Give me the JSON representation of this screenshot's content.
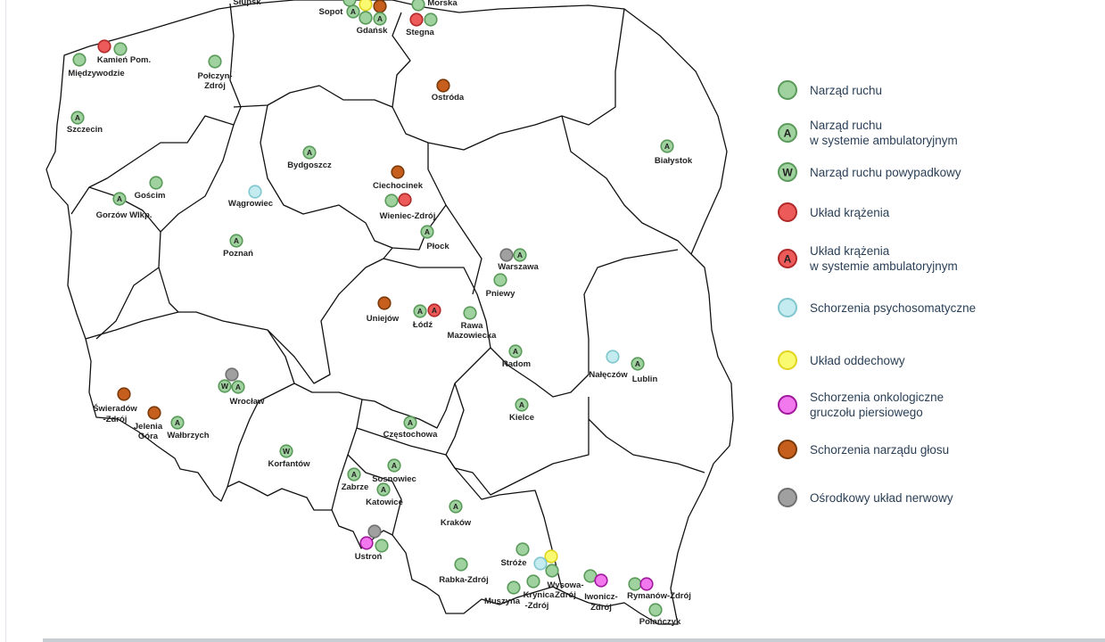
{
  "map": {
    "category_colors": {
      "ruch": "#9fd29f",
      "krazenie": "#ec5a5a",
      "psycho": "#c4ebef",
      "oddech": "#fafa70",
      "onko": "#f278ee",
      "glos": "#c65f1d",
      "nerw": "#a0a0a0"
    },
    "stroke_colors": {
      "ruch": "#5a9a5a",
      "krazenie": "#b02a2a",
      "psycho": "#7fc6cf",
      "oddech": "#e0d420",
      "onko": "#a0189c",
      "glos": "#7a3a0a",
      "nerw": "#707070"
    },
    "markers": [
      {
        "id": "gdynia-yellow",
        "cat": "oddech",
        "letter": ""
      },
      {
        "id": "gdansk-brown",
        "cat": "glos",
        "letter": ""
      },
      {
        "id": "sopot-ruch",
        "cat": "ruch",
        "letter": ""
      },
      {
        "id": "sopot-a",
        "cat": "ruch",
        "letter": "A"
      },
      {
        "id": "gdansk-ruch",
        "cat": "ruch",
        "letter": ""
      },
      {
        "id": "gdansk-a",
        "cat": "ruch",
        "letter": "A"
      },
      {
        "id": "slupsk-ruch",
        "cat": "ruch",
        "letter": ""
      },
      {
        "id": "morska-ruch",
        "cat": "ruch",
        "letter": ""
      },
      {
        "id": "stegna-red",
        "cat": "krazenie",
        "letter": ""
      },
      {
        "id": "stegna-ruch",
        "cat": "ruch",
        "letter": ""
      },
      {
        "id": "kamien-red",
        "cat": "krazenie",
        "letter": ""
      },
      {
        "id": "kamien-ruch",
        "cat": "ruch",
        "letter": ""
      },
      {
        "id": "miedzywodzie-ruch",
        "cat": "ruch",
        "letter": ""
      },
      {
        "id": "polczyn-ruch",
        "cat": "ruch",
        "letter": ""
      },
      {
        "id": "szczecin-a",
        "cat": "ruch",
        "letter": "A"
      },
      {
        "id": "ostroda-brown",
        "cat": "glos",
        "letter": ""
      },
      {
        "id": "bialystok-a",
        "cat": "ruch",
        "letter": "A"
      },
      {
        "id": "bydgoszcz-a",
        "cat": "ruch",
        "letter": "A"
      },
      {
        "id": "ciechocinek-brown",
        "cat": "glos",
        "letter": ""
      },
      {
        "id": "wieniec-ruch",
        "cat": "ruch",
        "letter": ""
      },
      {
        "id": "wieniec-red",
        "cat": "krazenie",
        "letter": ""
      },
      {
        "id": "wagrowiec-psycho",
        "cat": "psycho",
        "letter": ""
      },
      {
        "id": "goscim-ruch",
        "cat": "ruch",
        "letter": ""
      },
      {
        "id": "gorzow-a",
        "cat": "ruch",
        "letter": "A"
      },
      {
        "id": "poznan-a",
        "cat": "ruch",
        "letter": "A"
      },
      {
        "id": "plock-a",
        "cat": "ruch",
        "letter": "A"
      },
      {
        "id": "warszawa-grey",
        "cat": "nerw",
        "letter": ""
      },
      {
        "id": "warszawa-a",
        "cat": "ruch",
        "letter": "A"
      },
      {
        "id": "pniewy-ruch",
        "cat": "ruch",
        "letter": ""
      },
      {
        "id": "uniejow-brown",
        "cat": "glos",
        "letter": ""
      },
      {
        "id": "lodz-a",
        "cat": "ruch",
        "letter": "A"
      },
      {
        "id": "lodz-reda",
        "cat": "krazenie",
        "letter": "A"
      },
      {
        "id": "rawa-ruch",
        "cat": "ruch",
        "letter": ""
      },
      {
        "id": "radom-a",
        "cat": "ruch",
        "letter": "A"
      },
      {
        "id": "naleczow-psycho",
        "cat": "psycho",
        "letter": ""
      },
      {
        "id": "lublin-a",
        "cat": "ruch",
        "letter": "A"
      },
      {
        "id": "kielce-a",
        "cat": "ruch",
        "letter": "A"
      },
      {
        "id": "wroclaw-grey",
        "cat": "nerw",
        "letter": ""
      },
      {
        "id": "wroclaw-w",
        "cat": "ruch",
        "letter": "W"
      },
      {
        "id": "wroclaw-a",
        "cat": "ruch",
        "letter": "A"
      },
      {
        "id": "swieradow-brown",
        "cat": "glos",
        "letter": ""
      },
      {
        "id": "jelenia-brown",
        "cat": "glos",
        "letter": ""
      },
      {
        "id": "walbrzych-a",
        "cat": "ruch",
        "letter": "A"
      },
      {
        "id": "czestochowa-a",
        "cat": "ruch",
        "letter": "A"
      },
      {
        "id": "korfantow-w",
        "cat": "ruch",
        "letter": "W"
      },
      {
        "id": "zabrze-a",
        "cat": "ruch",
        "letter": "A"
      },
      {
        "id": "sosnowiec-a",
        "cat": "ruch",
        "letter": "A"
      },
      {
        "id": "katowice-a",
        "cat": "ruch",
        "letter": "A"
      },
      {
        "id": "krakow-a",
        "cat": "ruch",
        "letter": "A"
      },
      {
        "id": "ustron-grey",
        "cat": "nerw",
        "letter": ""
      },
      {
        "id": "ustron-onko",
        "cat": "onko",
        "letter": ""
      },
      {
        "id": "ustron-ruch",
        "cat": "ruch",
        "letter": ""
      },
      {
        "id": "rabka-ruch",
        "cat": "ruch",
        "letter": ""
      },
      {
        "id": "stroze-ruch",
        "cat": "ruch",
        "letter": ""
      },
      {
        "id": "wysowa-yellow",
        "cat": "oddech",
        "letter": ""
      },
      {
        "id": "wysowa-psycho",
        "cat": "psycho",
        "letter": ""
      },
      {
        "id": "wysowa-ruch",
        "cat": "ruch",
        "letter": ""
      },
      {
        "id": "krynica-ruch",
        "cat": "ruch",
        "letter": ""
      },
      {
        "id": "muszyna-ruch",
        "cat": "ruch",
        "letter": ""
      },
      {
        "id": "iwonicz-ruch",
        "cat": "ruch",
        "letter": ""
      },
      {
        "id": "iwonicz-onko",
        "cat": "onko",
        "letter": ""
      },
      {
        "id": "rymanow-ruch",
        "cat": "ruch",
        "letter": ""
      },
      {
        "id": "rymanow-onko",
        "cat": "onko",
        "letter": ""
      },
      {
        "id": "polanczyk-ruch",
        "cat": "ruch",
        "letter": ""
      }
    ],
    "labels": [
      {
        "id": "slupsk",
        "text": "Słupsk"
      },
      {
        "id": "sopot",
        "text": "Sopot"
      },
      {
        "id": "gdansk",
        "text": "Gdańsk"
      },
      {
        "id": "morska",
        "text": "Morska"
      },
      {
        "id": "stegna",
        "text": "Stegna"
      },
      {
        "id": "kamien",
        "text": "Kamień Pom."
      },
      {
        "id": "miedzywodzie",
        "text": "Międzywodzie"
      },
      {
        "id": "polczyn1",
        "text": "Połczyn-"
      },
      {
        "id": "polczyn2",
        "text": "Zdrój"
      },
      {
        "id": "ostroda",
        "text": "Ostróda"
      },
      {
        "id": "szczecin",
        "text": "Szczecin"
      },
      {
        "id": "bialystok",
        "text": "Białystok"
      },
      {
        "id": "bydgoszcz",
        "text": "Bydgoszcz"
      },
      {
        "id": "ciechocinek",
        "text": "Ciechocinek"
      },
      {
        "id": "wieniec",
        "text": "Wieniec-Zdrój"
      },
      {
        "id": "wagrowiec",
        "text": "Wągrowiec"
      },
      {
        "id": "goscim",
        "text": "Gościm"
      },
      {
        "id": "gorzow",
        "text": "Gorzów Wlkp."
      },
      {
        "id": "poznan",
        "text": "Poznań"
      },
      {
        "id": "plock",
        "text": "Płock"
      },
      {
        "id": "warszawa",
        "text": "Warszawa"
      },
      {
        "id": "pniewy",
        "text": "Pniewy"
      },
      {
        "id": "uniejow",
        "text": "Uniejów"
      },
      {
        "id": "lodz",
        "text": "Łódź"
      },
      {
        "id": "rawa1",
        "text": "Rawa"
      },
      {
        "id": "rawa2",
        "text": "Mazowiecka"
      },
      {
        "id": "radom",
        "text": "Radom"
      },
      {
        "id": "naleczow",
        "text": "Nałęczów"
      },
      {
        "id": "lublin",
        "text": "Lublin"
      },
      {
        "id": "kielce",
        "text": "Kielce"
      },
      {
        "id": "wroclaw",
        "text": "Wrocław"
      },
      {
        "id": "swieradow1",
        "text": "Świeradów"
      },
      {
        "id": "swieradow2",
        "text": "-Zdrój"
      },
      {
        "id": "jelenia1",
        "text": "Jelenia"
      },
      {
        "id": "jelenia2",
        "text": "Góra"
      },
      {
        "id": "walbrzych",
        "text": "Wałbrzych"
      },
      {
        "id": "czestochowa",
        "text": "Częstochowa"
      },
      {
        "id": "korfantow",
        "text": "Korfantów"
      },
      {
        "id": "zabrze",
        "text": "Zabrze"
      },
      {
        "id": "sosnowiec",
        "text": "Sosnowiec"
      },
      {
        "id": "katowice",
        "text": "Katowice"
      },
      {
        "id": "krakow",
        "text": "Kraków"
      },
      {
        "id": "ustron",
        "text": "Ustroń"
      },
      {
        "id": "rabka",
        "text": "Rabka-Zdrój"
      },
      {
        "id": "stroze",
        "text": "Stróże"
      },
      {
        "id": "wysowa1",
        "text": "Wysowa-"
      },
      {
        "id": "wysowa2",
        "text": "Zdrój"
      },
      {
        "id": "krynica1",
        "text": "Krynica"
      },
      {
        "id": "krynica2",
        "text": "-Zdrój"
      },
      {
        "id": "muszyna",
        "text": "Muszyna"
      },
      {
        "id": "iwonicz1",
        "text": "Iwonicz-"
      },
      {
        "id": "iwonicz2",
        "text": "Zdrój"
      },
      {
        "id": "rymanow",
        "text": "Rymanów-Zdrój"
      },
      {
        "id": "polanczyk",
        "text": "Polańczyk"
      }
    ]
  },
  "legend": {
    "items": [
      {
        "cat": "ruch",
        "letter": "",
        "label": "Narząd ruchu"
      },
      {
        "cat": "ruch",
        "letter": "A",
        "label": "Narząd ruchu\nw systemie ambulatoryjnym"
      },
      {
        "cat": "ruch",
        "letter": "W",
        "label": "Narząd ruchu powypadkowy"
      },
      {
        "cat": "krazenie",
        "letter": "",
        "label": "Układ krążenia"
      },
      {
        "cat": "krazenie",
        "letter": "A",
        "label": "Układ krążenia\nw systemie ambulatoryjnym"
      },
      {
        "cat": "psycho",
        "letter": "",
        "label": "Schorzenia psychosomatyczne"
      },
      {
        "cat": "oddech",
        "letter": "",
        "label": "Układ oddechowy"
      },
      {
        "cat": "onko",
        "letter": "",
        "label": "Schorzenia onkologiczne\ngruczołu piersiowego"
      },
      {
        "cat": "glos",
        "letter": "",
        "label": "Schorzenia narządu głosu"
      },
      {
        "cat": "nerw",
        "letter": "",
        "label": "Ośrodkowy układ nerwowy"
      }
    ]
  }
}
